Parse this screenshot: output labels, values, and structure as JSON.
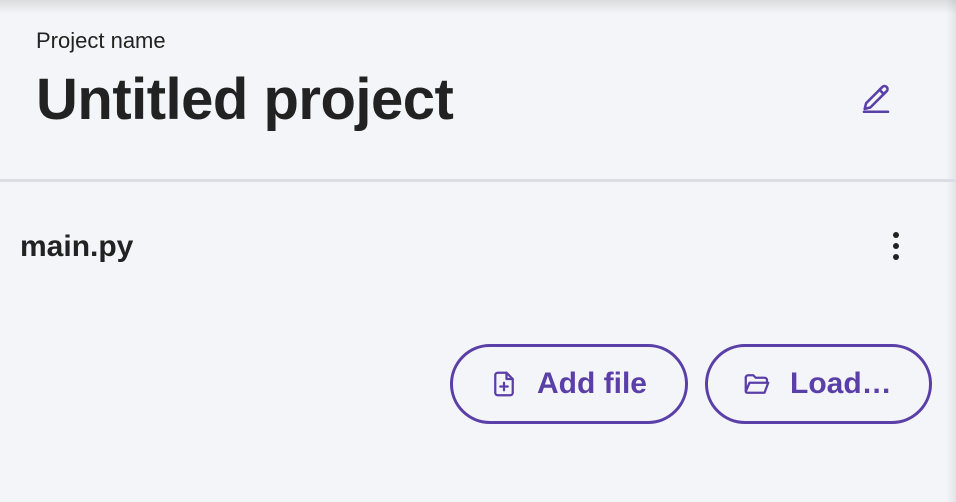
{
  "header": {
    "label": "Project name",
    "title": "Untitled project"
  },
  "files": [
    {
      "name": "main.py"
    }
  ],
  "actions": {
    "add_file_label": "Add file",
    "load_label": "Load…"
  },
  "icons": {
    "edit": "pencil-icon",
    "menu": "more-vertical-icon",
    "add_file": "file-plus-icon",
    "load": "folder-open-icon"
  },
  "colors": {
    "accent": "#5b3fa8",
    "text": "#222222",
    "background": "#f4f5f8",
    "divider": "#dcdde2"
  }
}
